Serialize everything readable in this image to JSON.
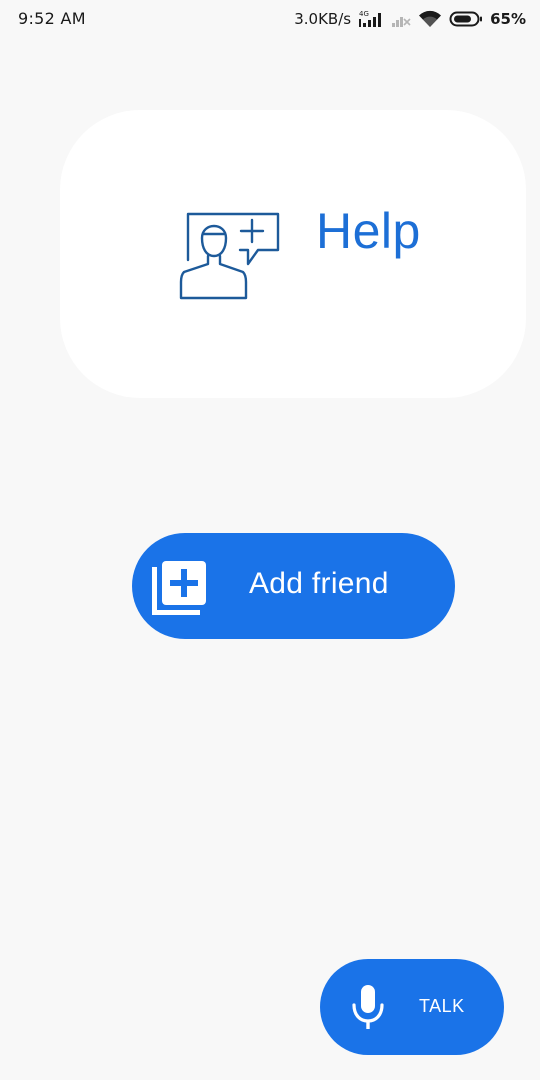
{
  "status_bar": {
    "time": "9:52 AM",
    "network_speed": "3.0KB/s",
    "network_type": "4G",
    "battery_percent": "65%",
    "icons": [
      "signal-4g-icon",
      "signal-no-service-icon",
      "wifi-icon",
      "battery-icon"
    ]
  },
  "help_card": {
    "label": "Help",
    "icon": "person-chat-plus-icon",
    "color": "#1d6fd6"
  },
  "add_friend": {
    "label": "Add friend",
    "icon": "library-add-icon",
    "color": "#1a73e8"
  },
  "talk": {
    "label": "TALK",
    "icon": "microphone-icon",
    "color": "#1a73e8"
  }
}
